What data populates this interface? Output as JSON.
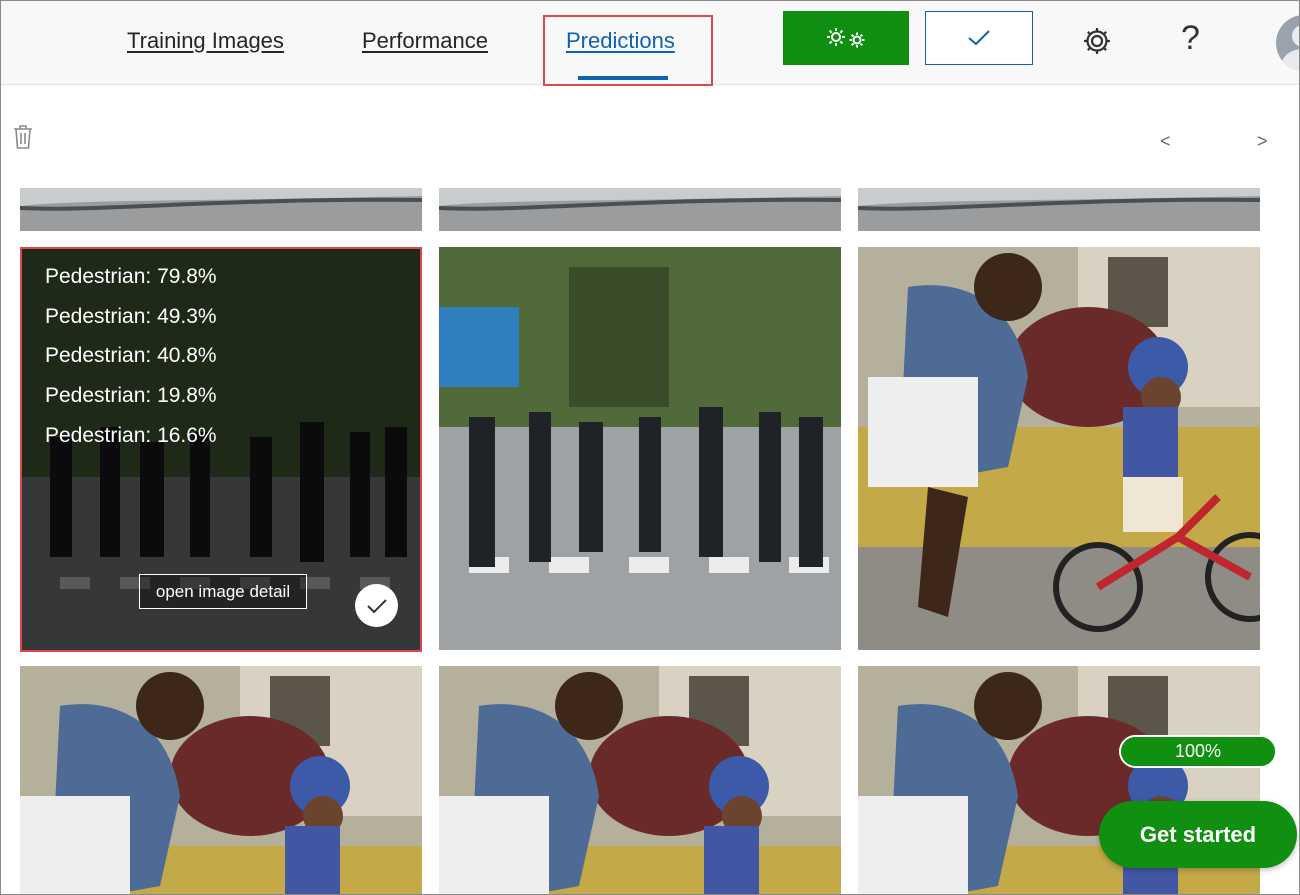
{
  "tabs": [
    {
      "label": "Training Images",
      "active": false
    },
    {
      "label": "Performance",
      "active": false
    },
    {
      "label": "Predictions",
      "active": true
    }
  ],
  "toolbar": {
    "train_icon": "gears-icon",
    "quick_test_icon": "checkmark-icon",
    "settings_icon": "gear-icon",
    "help_label": "?",
    "avatar_icon": "user-avatar-icon"
  },
  "gallery": {
    "delete_icon": "trash-icon",
    "prev_label": "<",
    "next_label": ">",
    "selected_image": {
      "predictions": [
        "Pedestrian: 79.8%",
        "Pedestrian: 49.3%",
        "Pedestrian: 40.8%",
        "Pedestrian: 19.8%",
        "Pedestrian: 16.6%"
      ],
      "detail_button": "open image detail",
      "select_icon": "checkmark-icon"
    },
    "images": [
      {
        "subject": "street"
      },
      {
        "subject": "street"
      },
      {
        "subject": "street"
      },
      {
        "subject": "crosswalk-pedestrians"
      },
      {
        "subject": "crosswalk-pedestrians"
      },
      {
        "subject": "man-and-child-bike"
      },
      {
        "subject": "man-and-child-bike"
      },
      {
        "subject": "man-and-child-bike"
      },
      {
        "subject": "man-and-child-bike"
      }
    ]
  },
  "progress": {
    "label": "100%",
    "value": 1.0
  },
  "get_started": {
    "label": "Get started"
  },
  "colors": {
    "accent_blue": "#0f62ae",
    "primary_green": "#118f11",
    "highlight_red": "#e0474c"
  }
}
